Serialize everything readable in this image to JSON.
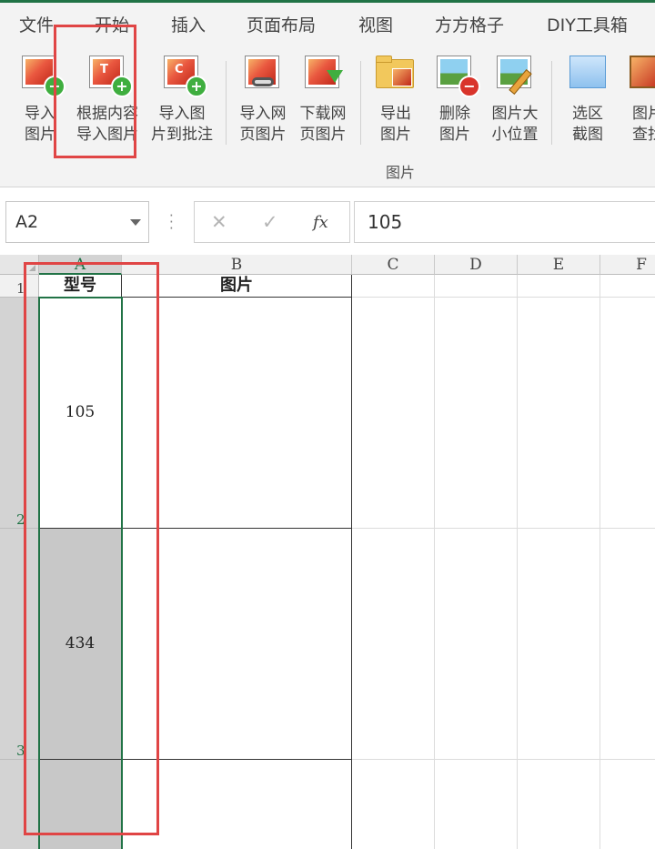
{
  "menu": {
    "tabs": [
      "文件",
      "开始",
      "插入",
      "页面布局",
      "视图",
      "方方格子",
      "DIY工具箱"
    ]
  },
  "ribbon": {
    "group_label": "图片",
    "buttons": [
      {
        "label": "导入\n图片",
        "icon": "import-picture-icon"
      },
      {
        "label": "根据内容\n导入图片",
        "icon": "import-by-content-icon"
      },
      {
        "label": "导入图\n片到批注",
        "icon": "import-to-comment-icon"
      },
      {
        "label": "导入网\n页图片",
        "icon": "import-web-picture-icon"
      },
      {
        "label": "下载网\n页图片",
        "icon": "download-web-picture-icon"
      },
      {
        "label": "导出\n图片",
        "icon": "export-picture-icon"
      },
      {
        "label": "删除\n图片",
        "icon": "delete-picture-icon"
      },
      {
        "label": "图片大\n小位置",
        "icon": "picture-size-position-icon"
      },
      {
        "label": "选区\n截图",
        "icon": "selection-screenshot-icon"
      },
      {
        "label": "图片\n查找",
        "icon": "picture-find-icon"
      }
    ]
  },
  "formula_bar": {
    "name_box": "A2",
    "value": "105",
    "cancel_glyph": "✕",
    "enter_glyph": "✓",
    "fx_glyph": "fx"
  },
  "sheet": {
    "columns": [
      "A",
      "B",
      "C",
      "D",
      "E",
      "F"
    ],
    "rows": [
      "1",
      "2",
      "3"
    ],
    "header_row": {
      "A": "型号",
      "B": "图片"
    },
    "data": [
      {
        "model": "105"
      },
      {
        "model": "434"
      }
    ]
  },
  "colors": {
    "accent": "#217346",
    "highlight_red": "#e04545",
    "selection_gray": "#c8c8c8"
  }
}
